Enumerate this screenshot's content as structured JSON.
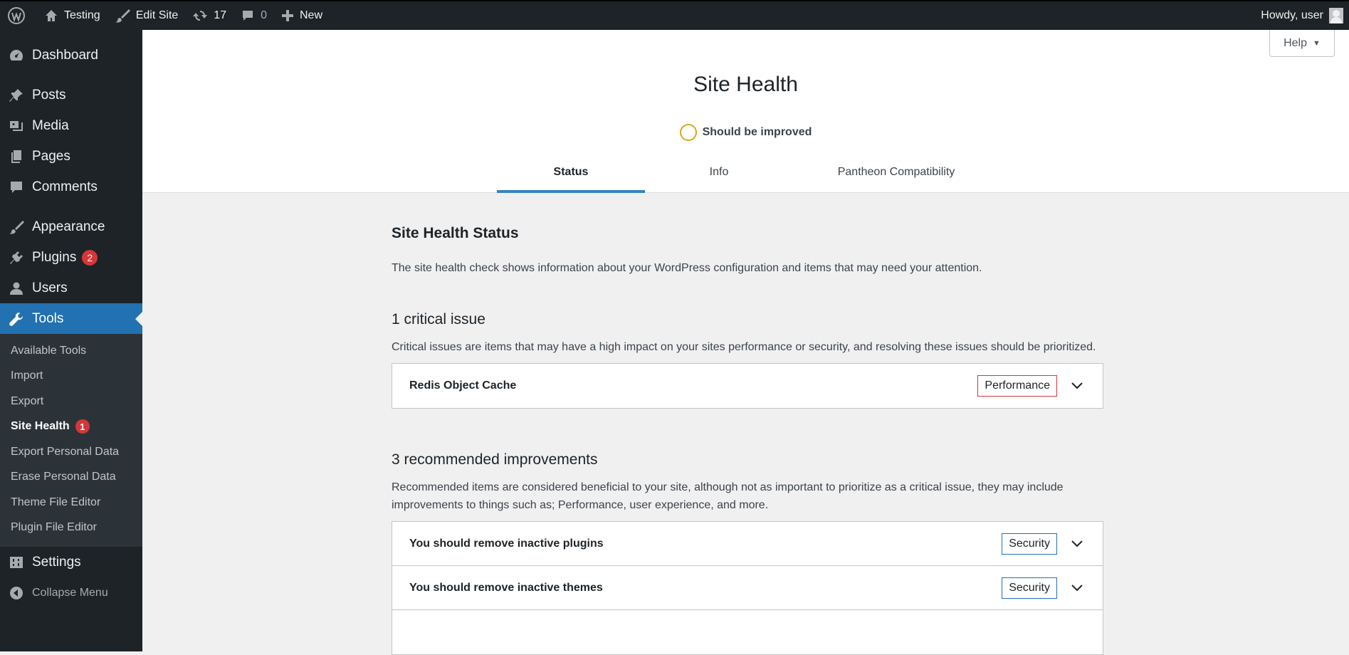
{
  "adminbar": {
    "site_name": "Testing",
    "edit_site": "Edit Site",
    "updates_count": "17",
    "comments_count": "0",
    "new_label": "New",
    "greeting": "Howdy, user"
  },
  "sidebar": {
    "items": [
      {
        "label": "Dashboard"
      },
      {
        "label": "Posts"
      },
      {
        "label": "Media"
      },
      {
        "label": "Pages"
      },
      {
        "label": "Comments"
      },
      {
        "label": "Appearance"
      },
      {
        "label": "Plugins",
        "badge": "2"
      },
      {
        "label": "Users"
      },
      {
        "label": "Tools"
      },
      {
        "label": "Settings"
      }
    ],
    "submenu": [
      {
        "label": "Available Tools"
      },
      {
        "label": "Import"
      },
      {
        "label": "Export"
      },
      {
        "label": "Site Health",
        "badge": "1"
      },
      {
        "label": "Export Personal Data"
      },
      {
        "label": "Erase Personal Data"
      },
      {
        "label": "Theme File Editor"
      },
      {
        "label": "Plugin File Editor"
      }
    ],
    "collapse_label": "Collapse Menu"
  },
  "header": {
    "help_label": "Help",
    "title": "Site Health",
    "score_label": "Should be improved",
    "tabs": [
      {
        "label": "Status"
      },
      {
        "label": "Info"
      },
      {
        "label": "Pantheon Compatibility"
      }
    ]
  },
  "main": {
    "section_title": "Site Health Status",
    "intro": "The site health check shows information about your WordPress configuration and items that may need your attention.",
    "critical": {
      "title": "1 critical issue",
      "description": "Critical issues are items that may have a high impact on your sites performance or security, and resolving these issues should be prioritized.",
      "items": [
        {
          "label": "Redis Object Cache",
          "tag": "Performance"
        }
      ]
    },
    "recommended": {
      "title": "3 recommended improvements",
      "description": "Recommended items are considered beneficial to your site, although not as important to prioritize as a critical issue, they may include improvements to things such as; Performance, user experience, and more.",
      "items": [
        {
          "label": "You should remove inactive plugins",
          "tag": "Security"
        },
        {
          "label": "You should remove inactive themes",
          "tag": "Security"
        }
      ]
    }
  },
  "colors": {
    "sidebar_bg": "#1d2327",
    "active_menu": "#2271b1",
    "badge": "#d63638",
    "score_ring": "#dba617",
    "critical_tag_border": "#d63638",
    "security_tag_border": "#2271b1"
  }
}
